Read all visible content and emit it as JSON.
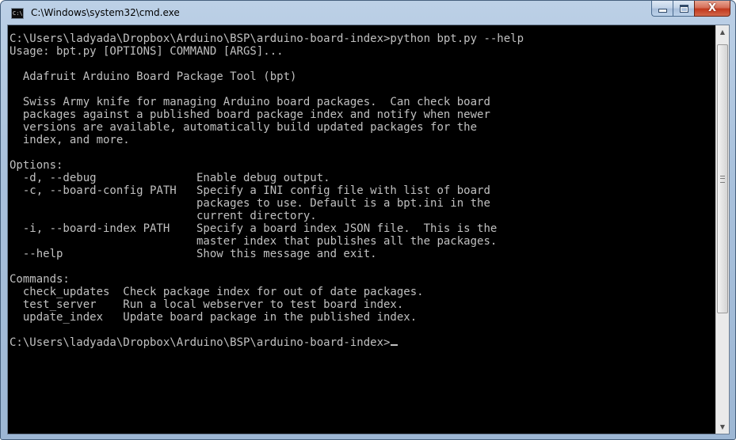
{
  "window": {
    "title": "C:\\Windows\\system32\\cmd.exe",
    "icon": "cmd-icon",
    "icon_text": "C:\\"
  },
  "caption_buttons": {
    "minimize_icon": "minimize-icon",
    "maximize_icon": "maximize-icon",
    "close_icon": "close-icon",
    "close_label": "X"
  },
  "console": {
    "lines": [
      "C:\\Users\\ladyada\\Dropbox\\Arduino\\BSP\\arduino-board-index>python bpt.py --help",
      "Usage: bpt.py [OPTIONS] COMMAND [ARGS]...",
      "",
      "  Adafruit Arduino Board Package Tool (bpt)",
      "",
      "  Swiss Army knife for managing Arduino board packages.  Can check board",
      "  packages against a published board package index and notify when newer",
      "  versions are available, automatically build updated packages for the",
      "  index, and more.",
      "",
      "Options:",
      "  -d, --debug               Enable debug output.",
      "  -c, --board-config PATH   Specify a INI config file with list of board",
      "                            packages to use. Default is a bpt.ini in the",
      "                            current directory.",
      "  -i, --board-index PATH    Specify a board index JSON file.  This is the",
      "                            master index that publishes all the packages.",
      "  --help                    Show this message and exit.",
      "",
      "Commands:",
      "  check_updates  Check package index for out of date packages.",
      "  test_server    Run a local webserver to test board index.",
      "  update_index   Update board package in the published index.",
      "",
      "C:\\Users\\ladyada\\Dropbox\\Arduino\\BSP\\arduino-board-index>"
    ]
  },
  "scrollbar": {
    "up_arrow": "▲",
    "down_arrow": "▼"
  }
}
